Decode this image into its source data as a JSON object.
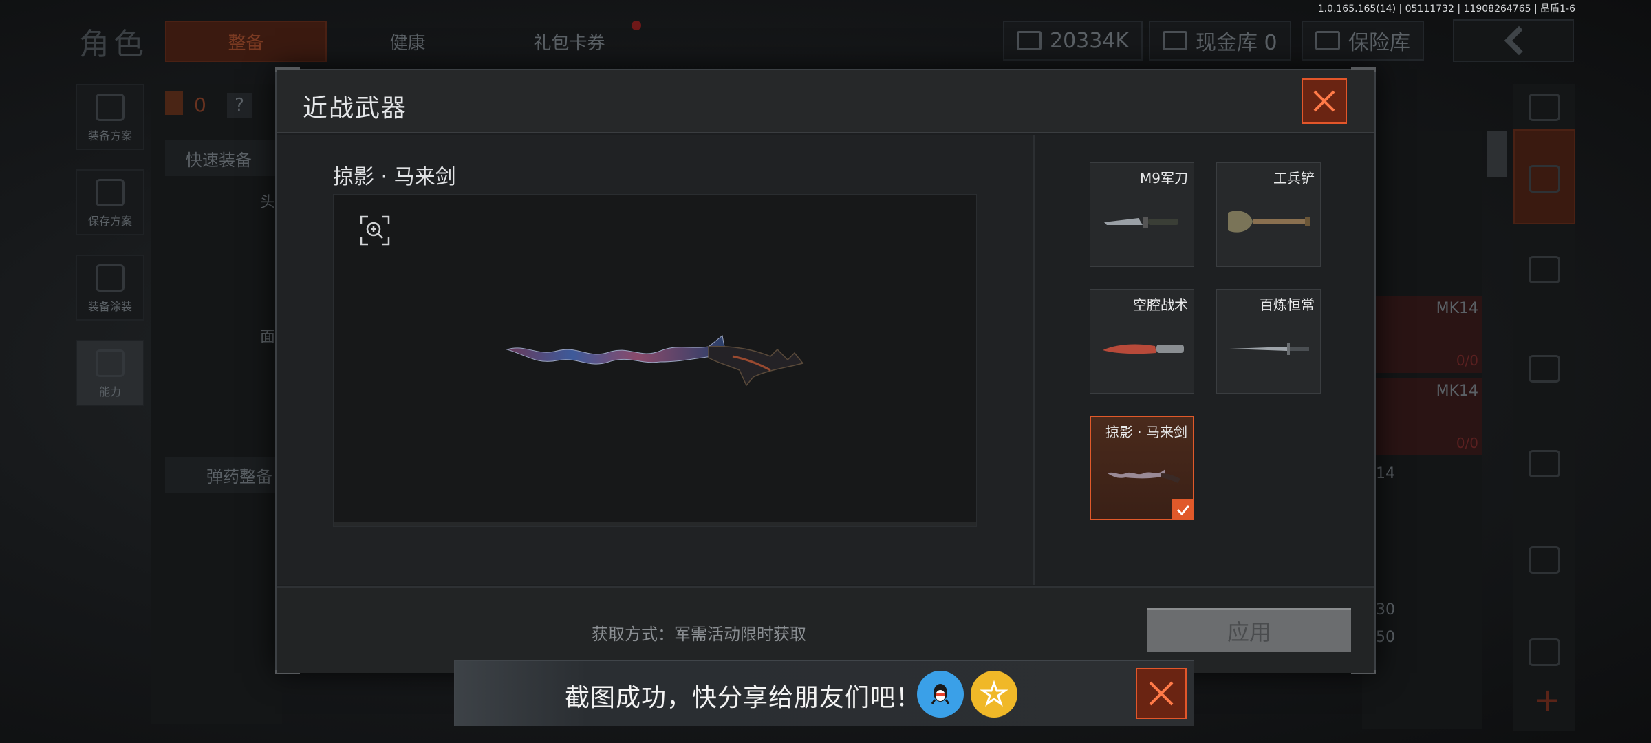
{
  "version_info": "1.0.165.165(14) | 05111732 | 11908264765 | 晶盾1-6",
  "background": {
    "page_title": "角色",
    "tabs": [
      "整备",
      "健康",
      "礼包卡券"
    ],
    "currency": {
      "amount": "20334K",
      "cash_vault": "现金库 0",
      "safe_vault": "保险库"
    },
    "left_menu": [
      "装备方案",
      "保存方案",
      "装备涂装",
      "能力"
    ],
    "quick_equip": "快速装备",
    "ammo_equip": "弹药整备",
    "count": "0",
    "question": "?",
    "side_labels": [
      "头",
      "面"
    ],
    "right_items": [
      {
        "name": "MK14",
        "count": "0/0"
      },
      {
        "name": "MK14",
        "count": "0/0"
      }
    ],
    "right_numbers": [
      "14",
      "30",
      "50"
    ]
  },
  "modal": {
    "title": "近战武器",
    "selected_weapon_name": "掠影 · 马来剑",
    "weapons": [
      {
        "label": "M9军刀",
        "icon": "knife-icon",
        "selected": false
      },
      {
        "label": "工兵铲",
        "icon": "shovel-icon",
        "selected": false
      },
      {
        "label": "空腔战术",
        "icon": "tactical-knife-icon",
        "selected": false
      },
      {
        "label": "百炼恒常",
        "icon": "sword-icon",
        "selected": false
      },
      {
        "label": "掠影 · 马来剑",
        "icon": "kris-sword-icon",
        "selected": true
      }
    ],
    "acquire_method": "获取方式：军需活动限时获取",
    "apply_label": "应用"
  },
  "share_bar": {
    "text": "截图成功，快分享给朋友们吧！",
    "icons": [
      "qq-icon",
      "qzone-icon"
    ]
  },
  "colors": {
    "accent": "#e0592a",
    "modal_bg": "#1c1e20",
    "apply_disabled": "#6b6d6f"
  }
}
